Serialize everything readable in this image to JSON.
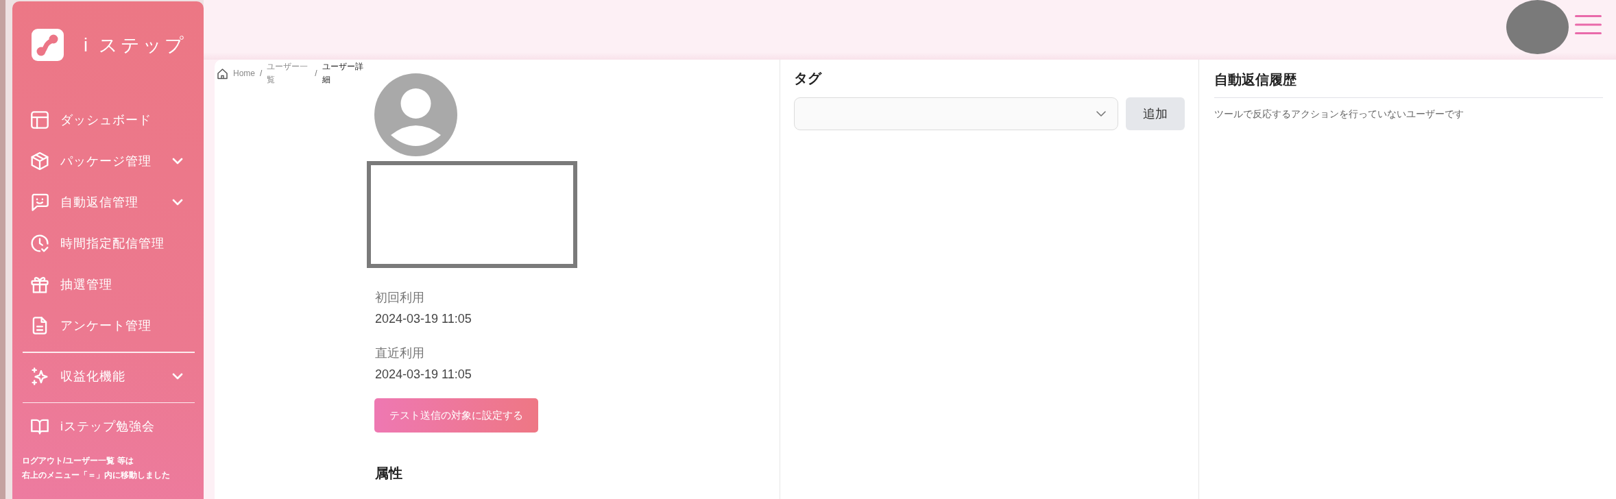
{
  "sidebar": {
    "logo_text": "i ステップ",
    "menu_sections": [
      {
        "items": [
          {
            "label": "ダッシュボード",
            "kind": "link"
          },
          {
            "label": "パッケージ管理",
            "kind": "group",
            "expanded": false
          },
          {
            "label": "自動返信管理",
            "kind": "group",
            "expanded": false
          },
          {
            "label": "時間指定配信管理",
            "kind": "link"
          },
          {
            "label": "抽選管理",
            "kind": "link"
          },
          {
            "label": "アンケート管理",
            "kind": "link"
          }
        ]
      },
      {
        "items": [
          {
            "label": "収益化機能",
            "kind": "group",
            "expanded": false
          }
        ]
      },
      {
        "items": [
          {
            "label": "iステップ勉強会",
            "kind": "link"
          }
        ]
      }
    ],
    "notice_lines": [
      "ログアウト/ユーザー一覧 等は",
      "右上のメニュー「＝」内に移動しました"
    ]
  },
  "breadcrumb": {
    "items": [
      {
        "label": "Home",
        "current": false
      },
      {
        "label": "ユーザー一覧",
        "current": false
      },
      {
        "label": "ユーザー詳細",
        "current": true
      }
    ],
    "separators": [
      "/",
      "/"
    ]
  },
  "profile": {
    "fields": [
      {
        "label": "初回利用",
        "value": "2024-03-19 11:05"
      },
      {
        "label": "直近利用",
        "value": "2024-03-19 11:05"
      }
    ],
    "test_button": "テスト送信の対象に設定する",
    "section_heading": "属性"
  },
  "tags": {
    "heading": "タグ",
    "add_button": "追加"
  },
  "auto_reply_history": {
    "heading": "自動返信履歴",
    "message": "ツールで反応するアクションを行っていないユーザーです"
  }
}
